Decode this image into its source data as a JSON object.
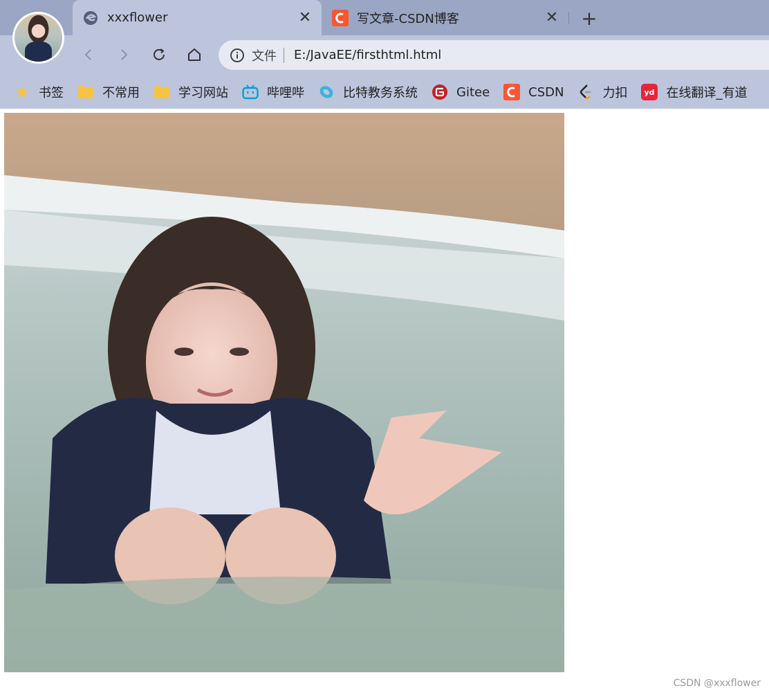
{
  "tabs": [
    {
      "title": "xxxflower",
      "active": true
    },
    {
      "title": "写文章-CSDN博客",
      "active": false
    }
  ],
  "toolbar": {
    "url_scheme": "文件",
    "url": "E:/JavaEE/firsthtml.html"
  },
  "bookmarks": [
    {
      "label": "书签",
      "icon": "star-icon"
    },
    {
      "label": "不常用",
      "icon": "folder-icon"
    },
    {
      "label": "学习网站",
      "icon": "folder-icon"
    },
    {
      "label": "哔哩哔",
      "icon": "bilibili-icon"
    },
    {
      "label": "比特教务系统",
      "icon": "bite-icon"
    },
    {
      "label": "Gitee",
      "icon": "gitee-icon"
    },
    {
      "label": "CSDN",
      "icon": "csdn-icon"
    },
    {
      "label": "力扣",
      "icon": "leetcode-icon"
    },
    {
      "label": "在线翻译_有道",
      "icon": "youdao-icon"
    }
  ],
  "watermark": "CSDN @xxxflower",
  "colors": {
    "tabstrip": "#9aa6c4",
    "toolbar": "#bcc5dc",
    "csdn": "#fc5531",
    "gitee": "#c71d23",
    "bilibili": "#00a1d6",
    "youdao": "#e8243b",
    "folder": "#f6c343"
  }
}
